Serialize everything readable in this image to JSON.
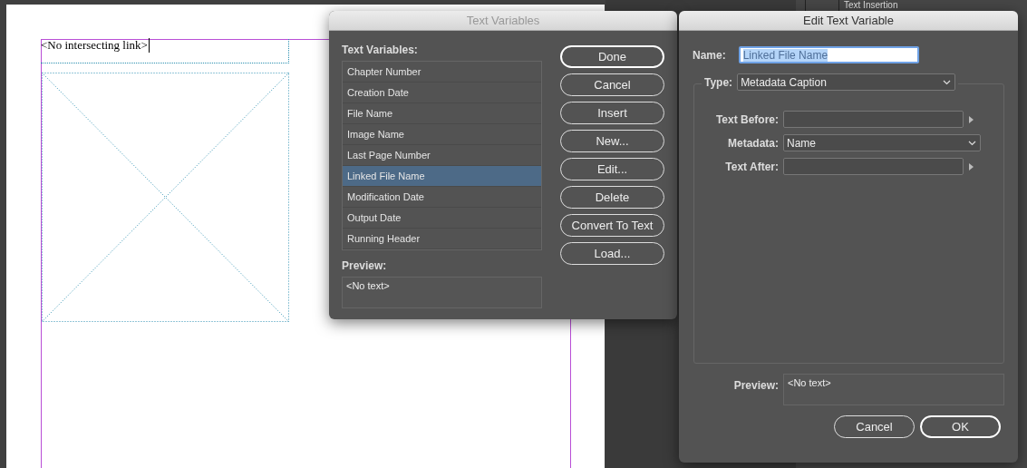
{
  "document": {
    "frame_text": "<No intersecting link>"
  },
  "background_panel": {
    "title": "Text Insertion"
  },
  "text_variables_dialog": {
    "title": "Text Variables",
    "active": false,
    "list_label": "Text Variables:",
    "items": [
      {
        "label": "Chapter Number",
        "selected": false
      },
      {
        "label": "Creation Date",
        "selected": false
      },
      {
        "label": "File Name",
        "selected": false
      },
      {
        "label": "Image Name",
        "selected": false
      },
      {
        "label": "Last Page Number",
        "selected": false
      },
      {
        "label": "Linked File Name",
        "selected": true
      },
      {
        "label": "Modification Date",
        "selected": false
      },
      {
        "label": "Output Date",
        "selected": false
      },
      {
        "label": "Running Header",
        "selected": false
      }
    ],
    "preview_label": "Preview:",
    "preview": "<No text>",
    "buttons": [
      {
        "label": "Done",
        "default": true
      },
      {
        "label": "Cancel",
        "default": false
      },
      {
        "label": "Insert",
        "default": false
      },
      {
        "label": "New...",
        "default": false
      },
      {
        "label": "Edit...",
        "default": false
      },
      {
        "label": "Delete",
        "default": false
      },
      {
        "label": "Convert To Text",
        "default": false
      },
      {
        "label": "Load...",
        "default": false
      }
    ]
  },
  "edit_dialog": {
    "title": "Edit Text Variable",
    "active": true,
    "name_label": "Name:",
    "name_value": "Linked File Name",
    "name_text_selected": true,
    "type_label": "Type:",
    "type_value": "Metadata Caption",
    "text_before_label": "Text Before:",
    "metadata_label": "Metadata:",
    "metadata_value": "Name",
    "text_after_label": "Text After:",
    "preview_label": "Preview:",
    "preview": "<No text>",
    "buttons": [
      {
        "label": "Cancel",
        "default": false
      },
      {
        "label": "OK",
        "default": true
      }
    ]
  }
}
